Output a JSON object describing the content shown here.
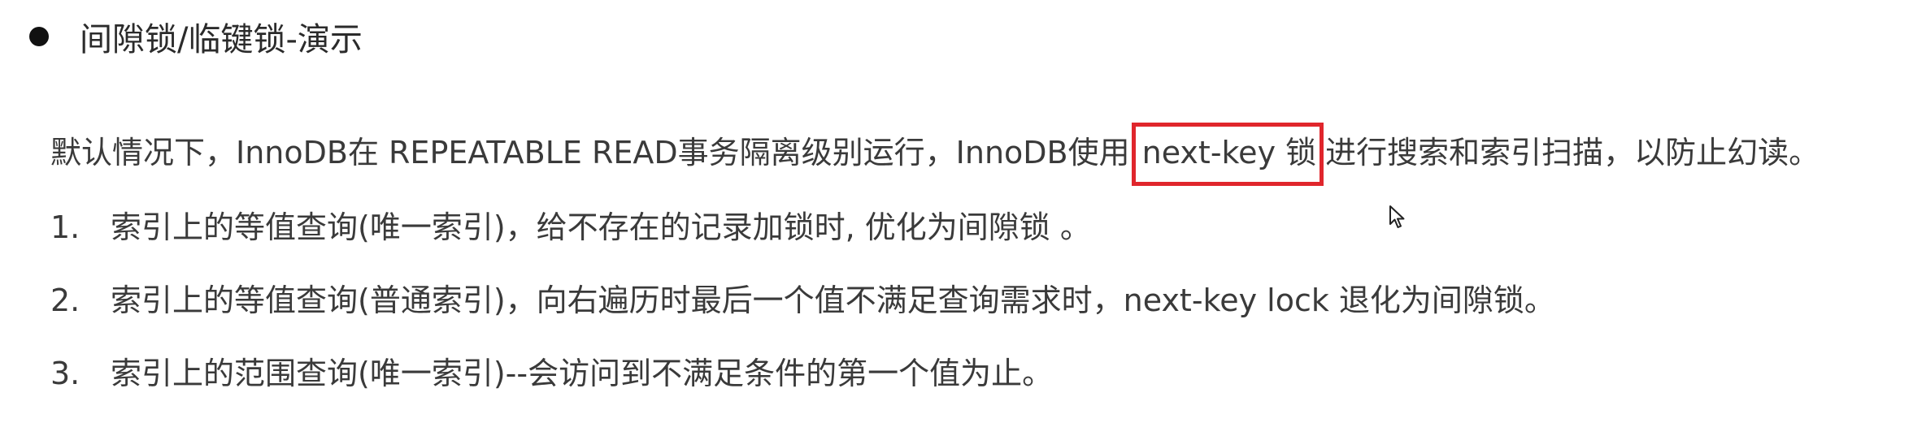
{
  "heading": {
    "text": "间隙锁/临键锁-演示"
  },
  "intro": {
    "before": "默认情况下，InnoDB在 REPEATABLE READ事务隔离级别运行，InnoDB使用",
    "highlight": "next-key 锁",
    "after": "进行搜索和索引扫描，以防止幻读。"
  },
  "list": [
    {
      "number": "1.",
      "text": "索引上的等值查询(唯一索引)，给不存在的记录加锁时, 优化为间隙锁 。"
    },
    {
      "number": "2.",
      "text": "索引上的等值查询(普通索引)，向右遍历时最后一个值不满足查询需求时，next-key lock 退化为间隙锁。"
    },
    {
      "number": "3.",
      "text": "索引上的范围查询(唯一索引)--会访问到不满足条件的第一个值为止。"
    }
  ],
  "colors": {
    "highlight_border": "#e0262c",
    "text": "#3a3a3a",
    "bullet": "#111111"
  },
  "icons": {
    "cursor": "mouse-pointer-icon"
  }
}
